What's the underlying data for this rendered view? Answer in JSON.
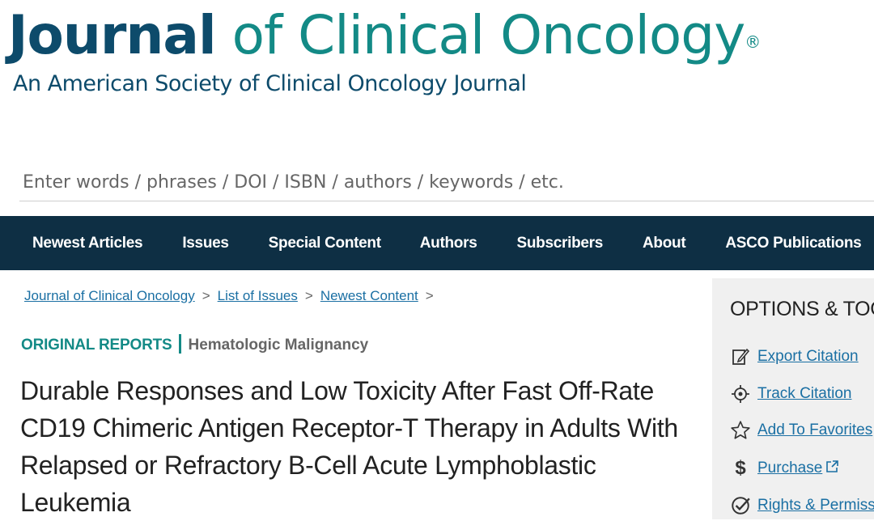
{
  "masthead": {
    "logo_bold": "Journal",
    "logo_light": " of Clinical Oncology",
    "logo_reg": "®",
    "tagline": "An American Society of Clinical Oncology Journal"
  },
  "search": {
    "placeholder": "Enter words / phrases / DOI / ISBN / authors / keywords / etc."
  },
  "nav": {
    "items": [
      "Newest Articles",
      "Issues",
      "Special Content",
      "Authors",
      "Subscribers",
      "About",
      "ASCO Publications"
    ]
  },
  "breadcrumb": {
    "items": [
      "Journal of Clinical Oncology",
      "List of Issues",
      "Newest Content"
    ],
    "separator": ">"
  },
  "article": {
    "type": "ORIGINAL REPORTS",
    "subtype": "Hematologic Malignancy",
    "title": "Durable Responses and Low Toxicity After Fast Off-Rate CD19 Chimeric Antigen Receptor-T Therapy in Adults With Relapsed or Refractory B-Cell Acute Lymphoblastic Leukemia"
  },
  "side_panel": {
    "title": "OPTIONS & TOOLS",
    "items": [
      {
        "label": "Export Citation",
        "icon": "edit-icon"
      },
      {
        "label": "Track Citation",
        "icon": "target-icon"
      },
      {
        "label": "Add To Favorites",
        "icon": "star-icon"
      },
      {
        "label": "Purchase",
        "icon": "dollar-icon"
      },
      {
        "label": "Rights & Permissions",
        "icon": "check-badge-icon"
      }
    ]
  },
  "colors": {
    "navy": "#0e2f44",
    "logo_dark": "#0d4b6b",
    "teal": "#138a86",
    "link": "#1a6fa3",
    "panel_bg": "#f0f0f0"
  }
}
